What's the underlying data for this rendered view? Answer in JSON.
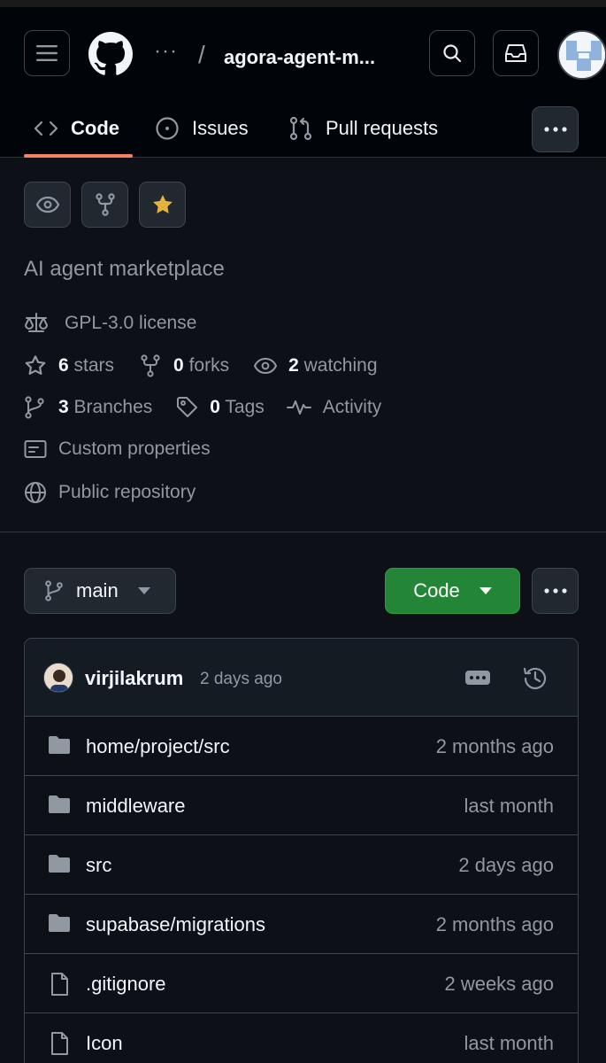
{
  "header": {
    "breadcrumb_dots": "···",
    "breadcrumb_separator": "/",
    "repo_name": "agora-agent-m..."
  },
  "tabs": [
    {
      "label": "Code",
      "icon": "code-icon"
    },
    {
      "label": "Issues",
      "icon": "issue-opened-icon"
    },
    {
      "label": "Pull requests",
      "icon": "git-pull-request-icon"
    }
  ],
  "about": {
    "description": "AI agent marketplace",
    "license": "GPL-3.0 license",
    "stars_count": "6",
    "stars_label": "stars",
    "forks_count": "0",
    "forks_label": "forks",
    "watching_count": "2",
    "watching_label": "watching",
    "branches_count": "3",
    "branches_label": "Branches",
    "tags_count": "0",
    "tags_label": "Tags",
    "activity_label": "Activity",
    "custom_properties_label": "Custom properties",
    "visibility_label": "Public repository"
  },
  "branch_bar": {
    "branch_name": "main",
    "code_button_label": "Code"
  },
  "commit": {
    "author": "virjilakrum",
    "time": "2 days ago"
  },
  "files": [
    {
      "name": "home/project/src",
      "date": "2 months ago",
      "type": "folder"
    },
    {
      "name": "middleware",
      "date": "last month",
      "type": "folder"
    },
    {
      "name": "src",
      "date": "2 days ago",
      "type": "folder"
    },
    {
      "name": "supabase/migrations",
      "date": "2 months ago",
      "type": "folder"
    },
    {
      "name": ".gitignore",
      "date": "2 weeks ago",
      "type": "file"
    },
    {
      "name": "Icon",
      "date": "last month",
      "type": "file"
    }
  ],
  "colors": {
    "background": "#0d1117",
    "header_background": "#010409",
    "accent_underline": "#f78166",
    "code_button_green": "#238636",
    "star_yellow": "#e3b341",
    "muted_text": "#9198a1"
  }
}
